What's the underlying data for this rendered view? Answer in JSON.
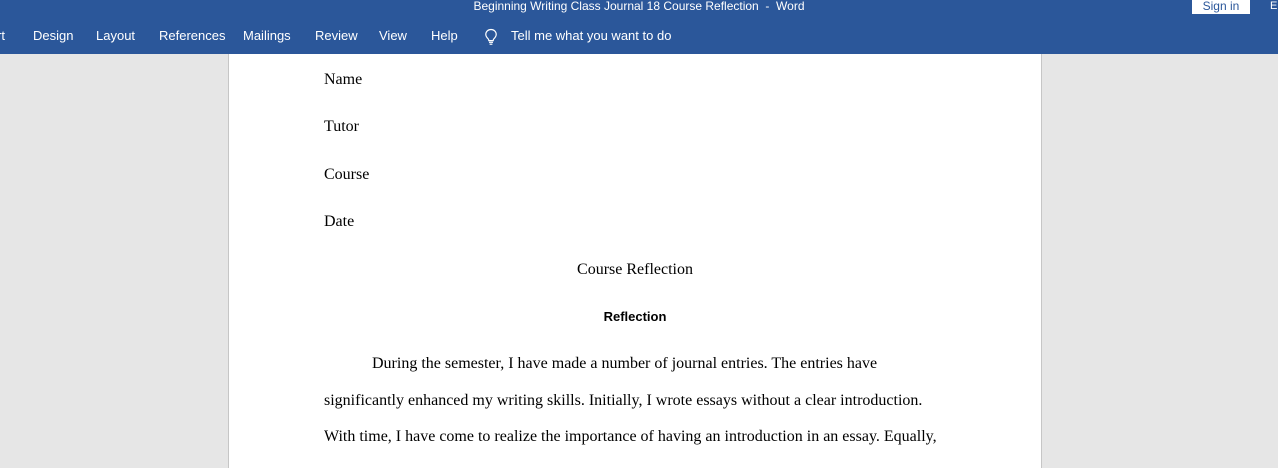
{
  "window": {
    "title": "Beginning Writing Class Journal 18 Course Reflection  -  Word",
    "sign_in_label": "Sign in",
    "edge_glyph": "E"
  },
  "ribbon": {
    "tabs": [
      {
        "label": "rt"
      },
      {
        "label": "Design"
      },
      {
        "label": "Layout"
      },
      {
        "label": "References"
      },
      {
        "label": "Mailings"
      },
      {
        "label": "Review"
      },
      {
        "label": "View"
      },
      {
        "label": "Help"
      }
    ],
    "tell_me": "Tell me what you want to do"
  },
  "document": {
    "header_lines": [
      "Name",
      "Tutor",
      "Course",
      "Date"
    ],
    "title": "Course Reflection",
    "section_heading": "Reflection",
    "body_lines": [
      "During the semester, I have made a number of journal entries. The entries have",
      "significantly enhanced my writing skills. Initially, I wrote essays without a clear introduction.",
      "With time, I have come to realize the importance of having an introduction in an essay. Equally,"
    ]
  },
  "colors": {
    "ribbon": "#2b579a",
    "workspace": "#e6e6e6",
    "page": "#ffffff"
  }
}
